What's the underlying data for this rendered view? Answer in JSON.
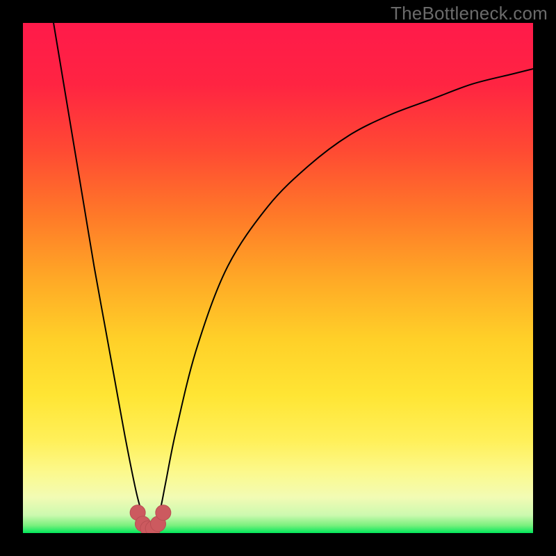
{
  "watermark": "TheBottleneck.com",
  "colors": {
    "frame": "#000000",
    "gradient_stops": [
      {
        "offset": 0.0,
        "color": "#ff1a4a"
      },
      {
        "offset": 0.12,
        "color": "#ff2442"
      },
      {
        "offset": 0.25,
        "color": "#ff4a33"
      },
      {
        "offset": 0.38,
        "color": "#ff7a28"
      },
      {
        "offset": 0.5,
        "color": "#ffa826"
      },
      {
        "offset": 0.62,
        "color": "#ffd028"
      },
      {
        "offset": 0.73,
        "color": "#ffe534"
      },
      {
        "offset": 0.82,
        "color": "#fff05a"
      },
      {
        "offset": 0.88,
        "color": "#fcf98c"
      },
      {
        "offset": 0.93,
        "color": "#f2fbb4"
      },
      {
        "offset": 0.965,
        "color": "#ccf9af"
      },
      {
        "offset": 0.985,
        "color": "#7af07e"
      },
      {
        "offset": 1.0,
        "color": "#00e85a"
      }
    ],
    "curve": "#000000",
    "marker_fill": "#cc5a5f",
    "marker_stroke": "#b94e53"
  },
  "chart_data": {
    "type": "line",
    "title": "",
    "xlabel": "",
    "ylabel": "",
    "xlim": [
      0,
      100
    ],
    "ylim": [
      0,
      100
    ],
    "series": [
      {
        "name": "bottleneck-curve",
        "x": [
          6,
          8,
          10,
          12,
          14,
          16,
          18,
          20,
          22,
          23,
          24,
          25,
          26,
          27,
          28,
          30,
          34,
          40,
          48,
          56,
          64,
          72,
          80,
          88,
          96,
          100
        ],
        "y": [
          100,
          88,
          76,
          64,
          52,
          41,
          30,
          19,
          9,
          5,
          2,
          1,
          2,
          5,
          10,
          20,
          36,
          52,
          64,
          72,
          78,
          82,
          85,
          88,
          90,
          91
        ]
      }
    ],
    "markers": {
      "name": "optimal-region",
      "x": [
        22.5,
        23.5,
        24.5,
        25.5,
        26.5,
        27.5
      ],
      "y": [
        4.0,
        1.8,
        0.9,
        0.9,
        1.8,
        4.0
      ]
    },
    "optimal_x": 25
  }
}
